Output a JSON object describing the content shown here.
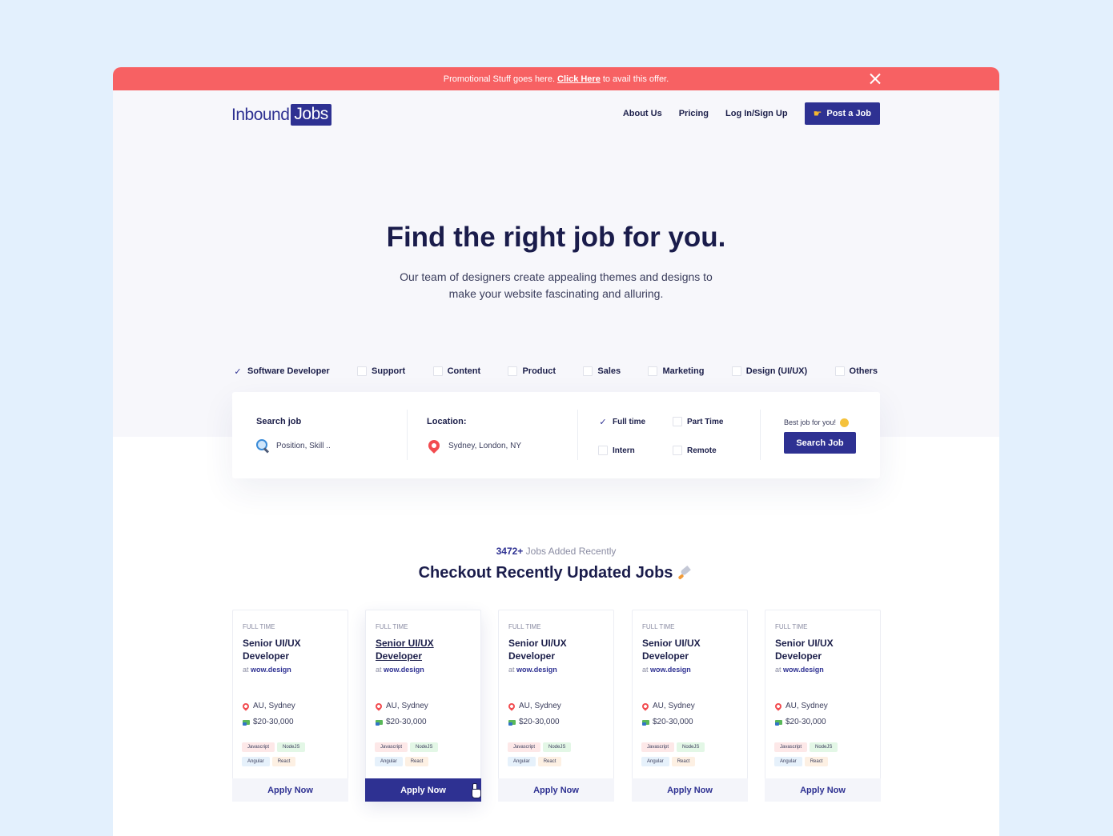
{
  "promo": {
    "text_before": "Promotional Stuff goes here.",
    "link": "Click Here",
    "text_after": "to avail this offer."
  },
  "brand": {
    "part1": "Inbound",
    "part2": "Jobs"
  },
  "nav": {
    "links": [
      "About Us",
      "Pricing",
      "Log In/Sign Up"
    ],
    "cta": "Post a Job"
  },
  "hero": {
    "title": "Find the right job for you.",
    "subtitle_line1": "Our team of designers create appealing themes and designs to",
    "subtitle_line2": "make your website fascinating and alluring."
  },
  "categories": [
    {
      "label": "Software Developer",
      "checked": true
    },
    {
      "label": "Support",
      "checked": false
    },
    {
      "label": "Content",
      "checked": false
    },
    {
      "label": "Product",
      "checked": false
    },
    {
      "label": "Sales",
      "checked": false
    },
    {
      "label": "Marketing",
      "checked": false
    },
    {
      "label": "Design (UI/UX)",
      "checked": false
    },
    {
      "label": "Others",
      "checked": false
    }
  ],
  "search": {
    "job_label": "Search job",
    "job_placeholder": "Position, Skill ..",
    "location_label": "Location:",
    "location_placeholder": "Sydney, London, NY",
    "types": [
      {
        "label": "Full time",
        "checked": true
      },
      {
        "label": "Part Time",
        "checked": false
      },
      {
        "label": "Intern",
        "checked": false
      },
      {
        "label": "Remote",
        "checked": false
      }
    ],
    "hint": "Best job for you!",
    "button": "Search Job"
  },
  "recent": {
    "count": "3472+",
    "count_suffix": "Jobs Added Recently",
    "title": "Checkout Recently Updated Jobs"
  },
  "jobs": [
    {
      "type": "FULL TIME",
      "title": "Senior UI/UX Developer",
      "at": "at",
      "company": "wow.design",
      "location": "AU, Sydney",
      "salary": "$20-30,000",
      "tags": [
        "Javascript",
        "NodeJS",
        "Angular",
        "React"
      ],
      "apply": "Apply Now"
    },
    {
      "type": "FULL TIME",
      "title": "Senior UI/UX Developer",
      "at": "at",
      "company": "wow.design",
      "location": "AU, Sydney",
      "salary": "$20-30,000",
      "tags": [
        "Javascript",
        "NodeJS",
        "Angular",
        "React"
      ],
      "apply": "Apply Now"
    },
    {
      "type": "FULL TIME",
      "title": "Senior UI/UX Developer",
      "at": "at",
      "company": "wow.design",
      "location": "AU, Sydney",
      "salary": "$20-30,000",
      "tags": [
        "Javascript",
        "NodeJS",
        "Angular",
        "React"
      ],
      "apply": "Apply Now"
    },
    {
      "type": "FULL TIME",
      "title": "Senior UI/UX Developer",
      "at": "at",
      "company": "wow.design",
      "location": "AU, Sydney",
      "salary": "$20-30,000",
      "tags": [
        "Javascript",
        "NodeJS",
        "Angular",
        "React"
      ],
      "apply": "Apply Now"
    },
    {
      "type": "FULL TIME",
      "title": "Senior UI/UX Developer",
      "at": "at",
      "company": "wow.design",
      "location": "AU, Sydney",
      "salary": "$20-30,000",
      "tags": [
        "Javascript",
        "NodeJS",
        "Angular",
        "React"
      ],
      "apply": "Apply Now"
    }
  ],
  "colors": {
    "accent": "#2e3192",
    "promo": "#f76163",
    "page_bg": "#e3f0fd"
  }
}
